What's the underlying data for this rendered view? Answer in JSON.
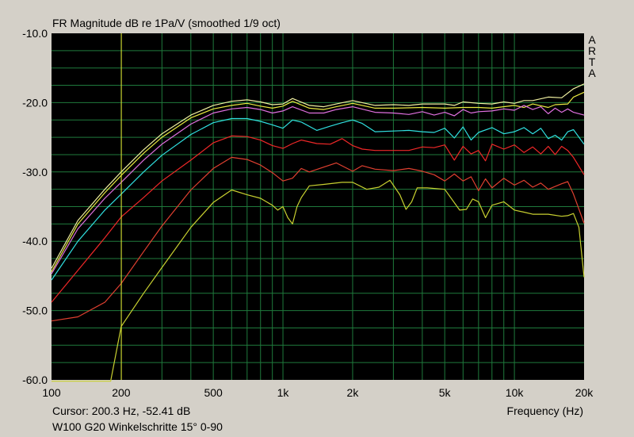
{
  "header": {
    "title": "FR Magnitude dB re 1Pa/V (smoothed 1/9 oct)"
  },
  "brand": {
    "letters": [
      "A",
      "R",
      "T",
      "A"
    ]
  },
  "footer": {
    "cursor": "Cursor: 200.3 Hz, -52.41 dB",
    "caption": "W100 G20  Winkelschritte 15° 0-90",
    "xlabel": "Frequency (Hz)"
  },
  "chart_data": {
    "type": "line",
    "title": "FR Magnitude dB re 1Pa/V (smoothed 1/9 oct)",
    "xlabel": "Frequency (Hz)",
    "ylabel": "",
    "x_scale": "log",
    "xlim": [
      100,
      20000
    ],
    "ylim": [
      -60,
      -10
    ],
    "grid": true,
    "background": "#000000",
    "grid_color": "#1f7a3c",
    "x_ticks": [
      {
        "value": 100,
        "label": "100"
      },
      {
        "value": 200,
        "label": "200"
      },
      {
        "value": 500,
        "label": "500"
      },
      {
        "value": 1000,
        "label": "1k"
      },
      {
        "value": 2000,
        "label": "2k"
      },
      {
        "value": 5000,
        "label": "5k"
      },
      {
        "value": 10000,
        "label": "10k"
      },
      {
        "value": 20000,
        "label": "20k"
      }
    ],
    "y_ticks": [
      {
        "value": -10,
        "label": "-10.0"
      },
      {
        "value": -20,
        "label": "-20.0"
      },
      {
        "value": -30,
        "label": "-30.0"
      },
      {
        "value": -40,
        "label": "-40.0"
      },
      {
        "value": -50,
        "label": "-50.0"
      },
      {
        "value": -60,
        "label": "-60.0"
      }
    ],
    "cursor": {
      "x": 200.3,
      "y": -52.41,
      "color": "#e8e830"
    },
    "series": [
      {
        "color": "#f0f0a0",
        "points": [
          [
            100,
            -43.9
          ],
          [
            130,
            -37
          ],
          [
            170,
            -32.5
          ],
          [
            200,
            -30
          ],
          [
            250,
            -26.8
          ],
          [
            300,
            -24.5
          ],
          [
            400,
            -21.8
          ],
          [
            500,
            -20.4
          ],
          [
            600,
            -19.8
          ],
          [
            700,
            -19.6
          ],
          [
            800,
            -19.9
          ],
          [
            900,
            -20.3
          ],
          [
            1000,
            -20.2
          ],
          [
            1100,
            -19.4
          ],
          [
            1300,
            -20.4
          ],
          [
            1500,
            -20.6
          ],
          [
            1700,
            -20.2
          ],
          [
            2000,
            -19.7
          ],
          [
            2200,
            -20
          ],
          [
            2500,
            -20.4
          ],
          [
            3000,
            -20.3
          ],
          [
            3500,
            -20.4
          ],
          [
            4000,
            -20.2
          ],
          [
            5000,
            -20.2
          ],
          [
            5500,
            -20.4
          ],
          [
            6000,
            -19.9
          ],
          [
            7000,
            -20.1
          ],
          [
            8000,
            -20.2
          ],
          [
            9000,
            -19.9
          ],
          [
            10000,
            -20.1
          ],
          [
            11000,
            -19.7
          ],
          [
            12000,
            -19.7
          ],
          [
            14000,
            -19.2
          ],
          [
            16000,
            -19.3
          ],
          [
            18000,
            -18
          ],
          [
            20000,
            -17.3
          ]
        ]
      },
      {
        "color": "#e8e840",
        "points": [
          [
            100,
            -44.4
          ],
          [
            130,
            -37.5
          ],
          [
            170,
            -33
          ],
          [
            200,
            -30.5
          ],
          [
            250,
            -27.3
          ],
          [
            300,
            -25
          ],
          [
            400,
            -22.2
          ],
          [
            500,
            -20.9
          ],
          [
            600,
            -20.4
          ],
          [
            700,
            -20.1
          ],
          [
            800,
            -20.5
          ],
          [
            900,
            -20.8
          ],
          [
            1000,
            -20.5
          ],
          [
            1100,
            -19.8
          ],
          [
            1300,
            -20.8
          ],
          [
            1500,
            -21
          ],
          [
            1700,
            -20.6
          ],
          [
            2000,
            -20.1
          ],
          [
            2500,
            -20.8
          ],
          [
            3000,
            -20.8
          ],
          [
            4000,
            -20.7
          ],
          [
            5000,
            -20.8
          ],
          [
            6000,
            -20.7
          ],
          [
            7000,
            -20.7
          ],
          [
            8000,
            -20.8
          ],
          [
            10000,
            -20.4
          ],
          [
            11000,
            -20.7
          ],
          [
            12000,
            -20.2
          ],
          [
            14000,
            -20.7
          ],
          [
            15000,
            -20.3
          ],
          [
            17000,
            -20.2
          ],
          [
            18000,
            -19.2
          ],
          [
            20000,
            -18.5
          ]
        ]
      },
      {
        "color": "#e070e0",
        "points": [
          [
            100,
            -44.7
          ],
          [
            130,
            -38.2
          ],
          [
            170,
            -33.8
          ],
          [
            200,
            -31.5
          ],
          [
            250,
            -28.3
          ],
          [
            300,
            -26
          ],
          [
            400,
            -23.1
          ],
          [
            500,
            -21.5
          ],
          [
            600,
            -20.9
          ],
          [
            700,
            -20.7
          ],
          [
            800,
            -21
          ],
          [
            900,
            -21.5
          ],
          [
            1000,
            -21.2
          ],
          [
            1100,
            -20.6
          ],
          [
            1300,
            -21.5
          ],
          [
            1500,
            -21.5
          ],
          [
            1700,
            -21
          ],
          [
            2000,
            -20.6
          ],
          [
            2500,
            -21.4
          ],
          [
            3000,
            -21.5
          ],
          [
            3500,
            -21.7
          ],
          [
            4000,
            -21.3
          ],
          [
            4500,
            -21.8
          ],
          [
            5000,
            -21.4
          ],
          [
            5500,
            -21.9
          ],
          [
            6000,
            -21
          ],
          [
            6500,
            -21.5
          ],
          [
            7000,
            -21.3
          ],
          [
            8000,
            -21.2
          ],
          [
            9000,
            -20.9
          ],
          [
            10000,
            -21.1
          ],
          [
            11000,
            -20.4
          ],
          [
            12000,
            -21
          ],
          [
            13000,
            -20.6
          ],
          [
            14000,
            -21.6
          ],
          [
            15000,
            -20.8
          ],
          [
            16000,
            -21.4
          ],
          [
            17000,
            -20.9
          ],
          [
            18000,
            -21.4
          ],
          [
            20000,
            -21.8
          ]
        ]
      },
      {
        "color": "#30e0e0",
        "points": [
          [
            100,
            -45.6
          ],
          [
            130,
            -40
          ],
          [
            170,
            -35.5
          ],
          [
            200,
            -33.2
          ],
          [
            250,
            -30
          ],
          [
            300,
            -27.6
          ],
          [
            400,
            -24.6
          ],
          [
            500,
            -22.9
          ],
          [
            600,
            -22.3
          ],
          [
            700,
            -22.3
          ],
          [
            800,
            -22.7
          ],
          [
            900,
            -23.2
          ],
          [
            1000,
            -23.7
          ],
          [
            1100,
            -22.5
          ],
          [
            1200,
            -22.8
          ],
          [
            1400,
            -24
          ],
          [
            1600,
            -23.4
          ],
          [
            1800,
            -22.9
          ],
          [
            2000,
            -22.5
          ],
          [
            2200,
            -23
          ],
          [
            2500,
            -24.2
          ],
          [
            3000,
            -24.1
          ],
          [
            3500,
            -24
          ],
          [
            4000,
            -24.2
          ],
          [
            4500,
            -24.3
          ],
          [
            5000,
            -23.7
          ],
          [
            5500,
            -25.1
          ],
          [
            6000,
            -23.5
          ],
          [
            6500,
            -25.4
          ],
          [
            7000,
            -24.3
          ],
          [
            8000,
            -23.6
          ],
          [
            9000,
            -24.5
          ],
          [
            10000,
            -24.2
          ],
          [
            11000,
            -23.6
          ],
          [
            12000,
            -24.5
          ],
          [
            13000,
            -23.7
          ],
          [
            14000,
            -25.2
          ],
          [
            15000,
            -24.7
          ],
          [
            16000,
            -25.4
          ],
          [
            17000,
            -24.2
          ],
          [
            18000,
            -23.9
          ],
          [
            20000,
            -26
          ]
        ]
      },
      {
        "color": "#f02828",
        "points": [
          [
            100,
            -48.8
          ],
          [
            130,
            -44.2
          ],
          [
            170,
            -39.5
          ],
          [
            200,
            -36.5
          ],
          [
            250,
            -33.7
          ],
          [
            300,
            -31.3
          ],
          [
            400,
            -28.3
          ],
          [
            500,
            -25.8
          ],
          [
            600,
            -24.8
          ],
          [
            700,
            -24.9
          ],
          [
            800,
            -25.4
          ],
          [
            900,
            -26.2
          ],
          [
            1000,
            -26.6
          ],
          [
            1100,
            -25.9
          ],
          [
            1200,
            -25.4
          ],
          [
            1400,
            -25.9
          ],
          [
            1600,
            -26
          ],
          [
            1800,
            -25.2
          ],
          [
            2000,
            -26.2
          ],
          [
            2200,
            -26.7
          ],
          [
            2500,
            -26.9
          ],
          [
            3000,
            -26.9
          ],
          [
            3500,
            -26.9
          ],
          [
            4000,
            -26.4
          ],
          [
            4500,
            -26.5
          ],
          [
            5000,
            -26.1
          ],
          [
            5500,
            -28.3
          ],
          [
            6000,
            -26.3
          ],
          [
            6500,
            -27.4
          ],
          [
            7000,
            -26.9
          ],
          [
            7500,
            -28.4
          ],
          [
            8000,
            -26
          ],
          [
            9000,
            -26.7
          ],
          [
            10000,
            -26.1
          ],
          [
            11000,
            -27.2
          ],
          [
            12000,
            -26.4
          ],
          [
            13000,
            -27.4
          ],
          [
            14000,
            -26.3
          ],
          [
            15000,
            -27.5
          ],
          [
            16000,
            -26.3
          ],
          [
            17000,
            -26.9
          ],
          [
            18000,
            -27.9
          ],
          [
            20000,
            -30.4
          ]
        ]
      },
      {
        "color": "#e04030",
        "points": [
          [
            100,
            -51.5
          ],
          [
            130,
            -50.9
          ],
          [
            170,
            -48.8
          ],
          [
            200,
            -46.1
          ],
          [
            250,
            -41.5
          ],
          [
            300,
            -37.8
          ],
          [
            400,
            -32.6
          ],
          [
            500,
            -29.5
          ],
          [
            600,
            -27.9
          ],
          [
            700,
            -28.2
          ],
          [
            800,
            -29
          ],
          [
            900,
            -30.1
          ],
          [
            1000,
            -31.3
          ],
          [
            1100,
            -30.9
          ],
          [
            1200,
            -29.5
          ],
          [
            1300,
            -30
          ],
          [
            1500,
            -29.3
          ],
          [
            1700,
            -28.7
          ],
          [
            2000,
            -29.9
          ],
          [
            2200,
            -29.1
          ],
          [
            2500,
            -29.6
          ],
          [
            3000,
            -29.8
          ],
          [
            3500,
            -29.5
          ],
          [
            4000,
            -29.9
          ],
          [
            4500,
            -30.4
          ],
          [
            5000,
            -31.3
          ],
          [
            5500,
            -30.3
          ],
          [
            6000,
            -31.3
          ],
          [
            6500,
            -30.7
          ],
          [
            7000,
            -32.7
          ],
          [
            7500,
            -31
          ],
          [
            8000,
            -32.3
          ],
          [
            9000,
            -30.9
          ],
          [
            10000,
            -31.9
          ],
          [
            11000,
            -31.2
          ],
          [
            12000,
            -32.2
          ],
          [
            13000,
            -31.6
          ],
          [
            14000,
            -32.5
          ],
          [
            16000,
            -31.7
          ],
          [
            17000,
            -31.4
          ],
          [
            18000,
            -33.2
          ],
          [
            20000,
            -37.4
          ]
        ]
      },
      {
        "color": "#c8d030",
        "points": [
          [
            100,
            -60.2
          ],
          [
            180,
            -60.2
          ],
          [
            200,
            -52.3
          ],
          [
            250,
            -47.5
          ],
          [
            300,
            -43.8
          ],
          [
            400,
            -38
          ],
          [
            500,
            -34.4
          ],
          [
            600,
            -32.6
          ],
          [
            700,
            -33.3
          ],
          [
            800,
            -33.8
          ],
          [
            900,
            -34.8
          ],
          [
            950,
            -35.5
          ],
          [
            1000,
            -35
          ],
          [
            1050,
            -36.6
          ],
          [
            1100,
            -37.5
          ],
          [
            1150,
            -35
          ],
          [
            1200,
            -33.7
          ],
          [
            1300,
            -32
          ],
          [
            1500,
            -31.8
          ],
          [
            1800,
            -31.5
          ],
          [
            2000,
            -31.5
          ],
          [
            2300,
            -32.5
          ],
          [
            2600,
            -32.2
          ],
          [
            2900,
            -31.2
          ],
          [
            3200,
            -33.3
          ],
          [
            3400,
            -35.4
          ],
          [
            3600,
            -34.3
          ],
          [
            3800,
            -32.3
          ],
          [
            4200,
            -32.3
          ],
          [
            5000,
            -32.5
          ],
          [
            5800,
            -35.5
          ],
          [
            6200,
            -35.4
          ],
          [
            6600,
            -33.9
          ],
          [
            7000,
            -34.3
          ],
          [
            7500,
            -36.6
          ],
          [
            8000,
            -34.8
          ],
          [
            9000,
            -34.3
          ],
          [
            10000,
            -35.5
          ],
          [
            11000,
            -35.8
          ],
          [
            12000,
            -36.1
          ],
          [
            14000,
            -36.1
          ],
          [
            16000,
            -36.4
          ],
          [
            17000,
            -36.3
          ],
          [
            18000,
            -36
          ],
          [
            19000,
            -38
          ],
          [
            20000,
            -45.2
          ]
        ]
      }
    ]
  }
}
